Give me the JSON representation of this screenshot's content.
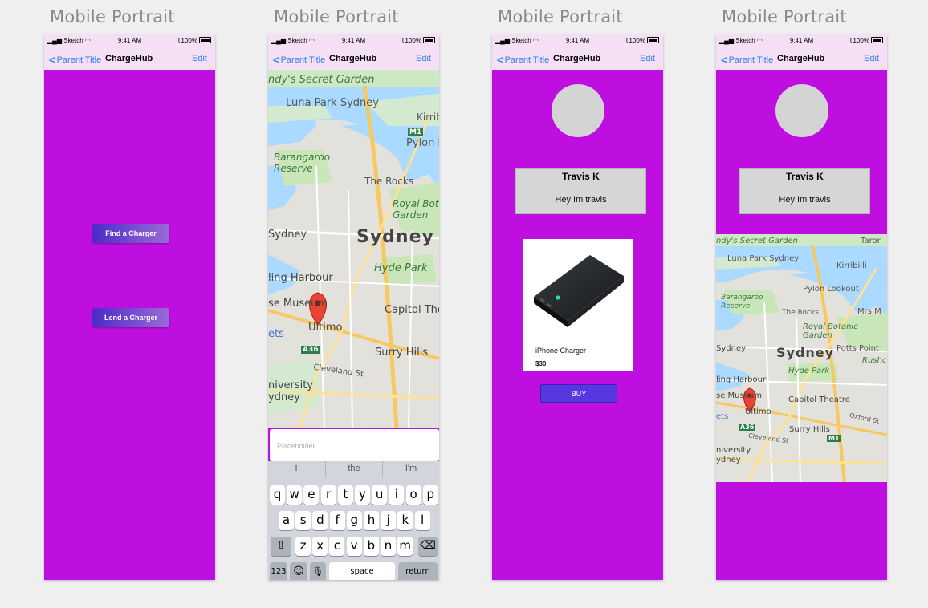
{
  "artboard_title": "Mobile Portrait",
  "statusbar": {
    "signal": "Sketch",
    "time": "9:41 AM",
    "battery": "100%"
  },
  "navbar": {
    "back": "Parent Title",
    "title": "ChargeHub",
    "edit": "Edit"
  },
  "colors": {
    "screen_bg": "#bf0fe0",
    "nav_bg": "#f4dff5",
    "link": "#2f7cf6",
    "buy_button": "#5637e0"
  },
  "screen1": {
    "find_button": "Find a Charger",
    "lend_button": "Lend a Charger"
  },
  "map_labels": {
    "secret_garden": "ndy's Secret Garden",
    "luna_park": "Luna Park Sydney",
    "kirribilli": "Kirribilli",
    "pylon": "Pylon Lookout",
    "barangaroo_1": "Barangaroo",
    "barangaroo_2": "Reserve",
    "the_rocks": "The Rocks",
    "royal_botanic_1": "Royal Botanic",
    "royal_botanic_2": "Garden",
    "sydney": "Sydney",
    "sydney_big": "Sydney",
    "hyde_park": "Hyde Park",
    "darling_harbour": "ling Harbour",
    "museum": "se Museum",
    "ultimo": "Ultimo",
    "capitol": "Capitol Theatre",
    "surry_hills": "Surry Hills",
    "cleveland": "Cleveland St",
    "university_1": "niversity",
    "university_2": "ydney",
    "a36": "A36",
    "m1": "M1",
    "ets": "ets",
    "potts_point": "Potts Point",
    "mrs_m": "Mrs M",
    "rushcutters": "Rushcu",
    "oxford": "Oxford St",
    "taronga": "Taror"
  },
  "screen2": {
    "placeholder": "Placeholder",
    "suggestions": [
      "I",
      "the",
      "I'm"
    ],
    "rows": [
      [
        "q",
        "w",
        "e",
        "r",
        "t",
        "y",
        "u",
        "i",
        "o",
        "p"
      ],
      [
        "a",
        "s",
        "d",
        "f",
        "g",
        "h",
        "j",
        "k",
        "l"
      ],
      [
        "z",
        "x",
        "c",
        "v",
        "b",
        "n",
        "m"
      ]
    ],
    "key_123": "123",
    "key_space": "space",
    "key_return": "return",
    "shift_icon": "⇧",
    "delete_icon": "⌫",
    "emoji_icon": "☺",
    "mic_icon": "🎙"
  },
  "profile": {
    "name": "Travis K",
    "bio": "Hey Im travis"
  },
  "product": {
    "name": "iPhone Charger",
    "price": "$30",
    "buy": "BUY"
  }
}
